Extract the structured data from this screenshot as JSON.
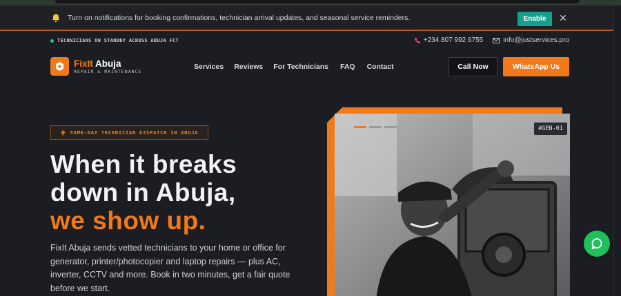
{
  "notification": {
    "message": "Turn on notifications for booking confirmations, technician arrival updates, and seasonal service reminders.",
    "enable_label": "Enable"
  },
  "infobar": {
    "standby_text": "TECHNICIANS ON STANDBY ACROSS ABUJA FCT",
    "phone": "+234 807 992 6755",
    "email": "info@justservices.pro"
  },
  "brand": {
    "name_part1": "FixIt",
    "name_part2": " Abuja",
    "tagline": "REPAIR & MAINTENANCE"
  },
  "nav": {
    "items": [
      "Services",
      "Reviews",
      "For Technicians",
      "FAQ",
      "Contact"
    ],
    "call_label": "Call Now",
    "whatsapp_label": "WhatsApp Us"
  },
  "hero": {
    "badge": "SAME-DAY TECHNICIAN DISPATCH IN ABUJA",
    "headline_line1": "When it breaks",
    "headline_line2": "down in Abuja,",
    "headline_accent": "we show up.",
    "description": "FixIt Abuja sends vetted technicians to your home or office for generator, printer/photocopier and laptop repairs — plus AC, inverter, CCTV and more. Book in two minutes, get a fair quote before we start.",
    "image_tag": "#GEN-01"
  },
  "colors": {
    "accent": "#f07a1a",
    "teal": "#14a08a",
    "chat_green": "#1fc15b",
    "background": "#1c1d22"
  }
}
